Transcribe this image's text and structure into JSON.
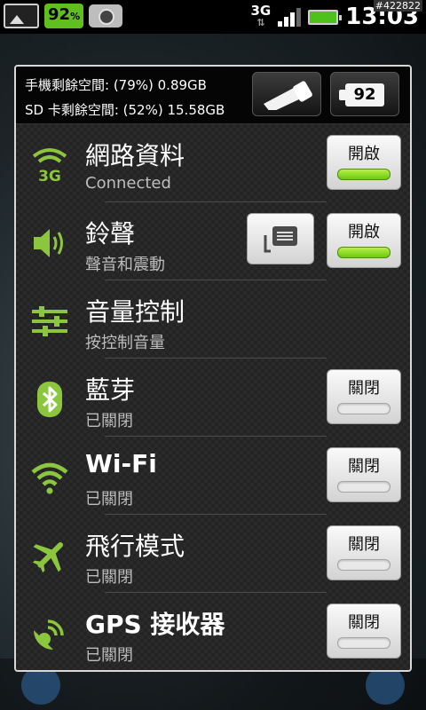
{
  "status_bar": {
    "battery_percent_label": "92",
    "battery_percent_sign": "%",
    "network_type": "3G",
    "network_arrows": "⇅",
    "time": "13:03",
    "watermark": "#422822",
    "signal_bars_filled": 3,
    "signal_bars_total": 4
  },
  "panel": {
    "storage": {
      "phone_line": "手機剩餘空間: (79%) 0.89GB",
      "sd_line": "SD 卡剩餘空間: (52%) 15.58GB"
    },
    "battery_button_value": "92",
    "rows": [
      {
        "icon": "3g-data-icon",
        "title": "網路資料",
        "subtitle": "Connected",
        "toggle_label": "開啟",
        "toggle_on": true
      },
      {
        "icon": "speaker-icon",
        "title": "鈴聲",
        "subtitle": "聲音和震動",
        "toggle_label": "開啟",
        "toggle_on": true,
        "extra_button": "message-icon"
      },
      {
        "icon": "sliders-icon",
        "title": "音量控制",
        "subtitle": "按控制音量"
      },
      {
        "icon": "bluetooth-icon",
        "title": "藍芽",
        "subtitle": "已關閉",
        "toggle_label": "關閉",
        "toggle_on": false
      },
      {
        "icon": "wifi-icon",
        "title": "Wi-Fi",
        "subtitle": "已關閉",
        "toggle_label": "關閉",
        "toggle_on": false
      },
      {
        "icon": "airplane-icon",
        "title": "飛行模式",
        "subtitle": "已關閉",
        "toggle_label": "關閉",
        "toggle_on": false
      },
      {
        "icon": "gps-icon",
        "title": "GPS 接收器",
        "subtitle": "已關閉",
        "toggle_label": "關閉",
        "toggle_on": false
      }
    ]
  },
  "colors": {
    "accent_green": "#8cc63e",
    "toggle_on_green": "#6cc80f",
    "battery_pill": "#5fbf1f"
  }
}
